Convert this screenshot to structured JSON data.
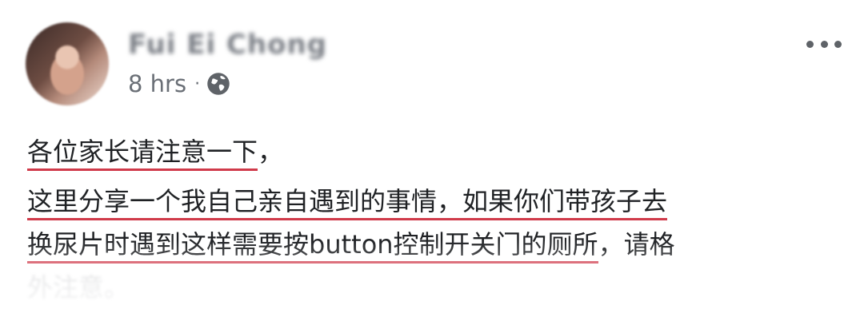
{
  "post": {
    "author": "Fui Ei Chong",
    "time": "8 hrs",
    "separator": "·",
    "privacy_icon": "globe-icon",
    "more_icon": "more-options-icon",
    "lines": [
      {
        "underlined": "各位家长请注意一下",
        "rest": "，"
      },
      {
        "underlined": "这里分享一个我自己亲自遇到的事情，如果你们带孩子去",
        "rest": ""
      },
      {
        "underlined": "换尿片时遇到这样需要按button控制开关门的厕所",
        "rest": "，请格"
      },
      {
        "underlined": "",
        "rest": "外注意。"
      }
    ]
  },
  "colors": {
    "underline": "#d03a4a",
    "text": "#1f2124",
    "meta": "#6a6f76"
  }
}
